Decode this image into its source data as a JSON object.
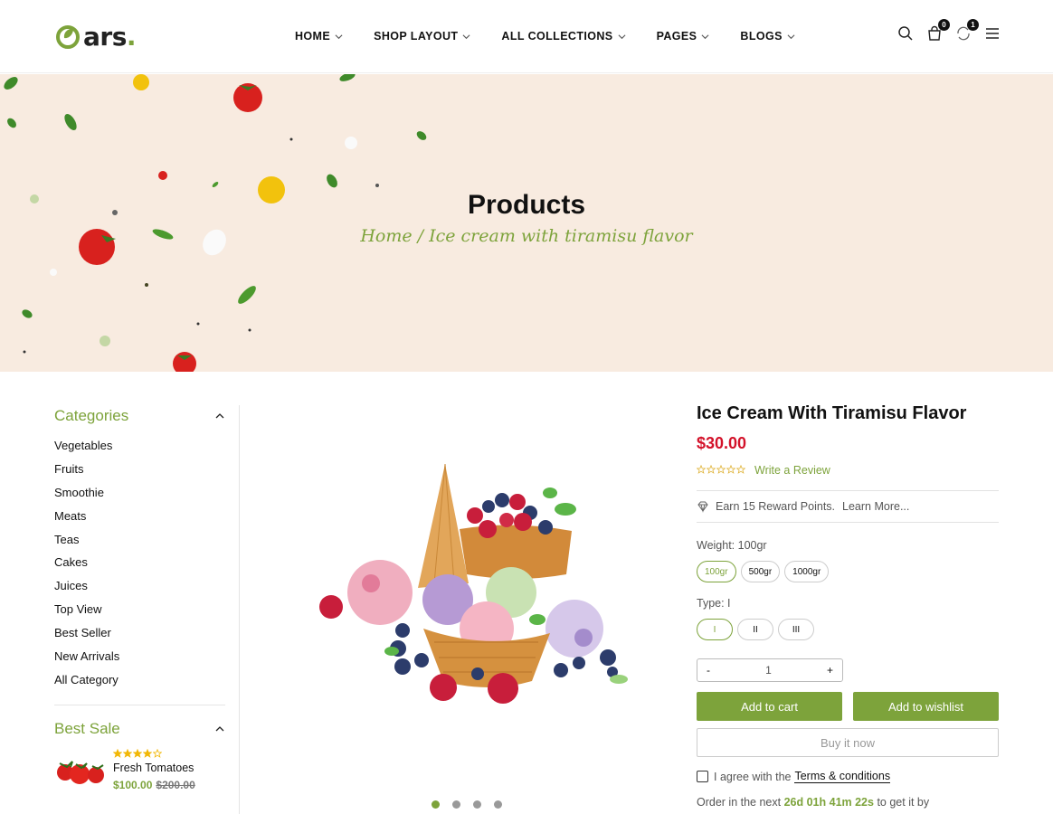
{
  "brand": {
    "logo_text": "ars",
    "logo_dot": "."
  },
  "nav": {
    "items": [
      {
        "label": "HOME"
      },
      {
        "label": "SHOP LAYOUT"
      },
      {
        "label": "ALL COLLECTIONS"
      },
      {
        "label": "PAGES"
      },
      {
        "label": "BLOGS"
      }
    ]
  },
  "header_icons": {
    "cart_count": "0",
    "compare_count": "1"
  },
  "banner": {
    "title": "Products",
    "breadcrumb_home": "Home",
    "breadcrumb_sep": " / ",
    "breadcrumb_current": "Ice cream with tiramisu flavor"
  },
  "sidebar": {
    "categories_title": "Categories",
    "categories": [
      "Vegetables",
      "Fruits",
      "Smoothie",
      "Meats",
      "Teas",
      "Cakes",
      "Juices",
      "Top View",
      "Best Seller",
      "New Arrivals",
      "All Category"
    ],
    "best_sale_title": "Best Sale",
    "best_sale": {
      "name": "Fresh Tomatoes",
      "price": "$100.00",
      "old_price": "$200.00",
      "rating": 4
    }
  },
  "product": {
    "title": "Ice Cream With Tiramisu Flavor",
    "price": "$30.00",
    "rating": 0,
    "write_review": "Write a Review",
    "reward": "Earn 15 Reward Points.",
    "learn_more": "Learn More...",
    "weight_label": "Weight: 100gr",
    "weights": [
      "100gr",
      "500gr",
      "1000gr"
    ],
    "selected_weight": "100gr",
    "type_label": "Type: I",
    "types": [
      "I",
      "II",
      "III"
    ],
    "selected_type": "I",
    "qty_minus": "-",
    "qty_value": "1",
    "qty_plus": "+",
    "add_to_cart": "Add to cart",
    "add_to_wishlist": "Add to wishlist",
    "buy_now": "Buy it now",
    "agree_text": "I agree with the",
    "terms": "Terms & conditions",
    "order_prefix": "Order in the next",
    "countdown": "26d 01h 41m 22s",
    "order_suffix": "to get it by",
    "carousel_active": 1,
    "carousel_count": 4
  },
  "colors": {
    "accent": "#7da33b",
    "price_red": "#d3122a",
    "banner_bg": "#f8ebe0"
  }
}
